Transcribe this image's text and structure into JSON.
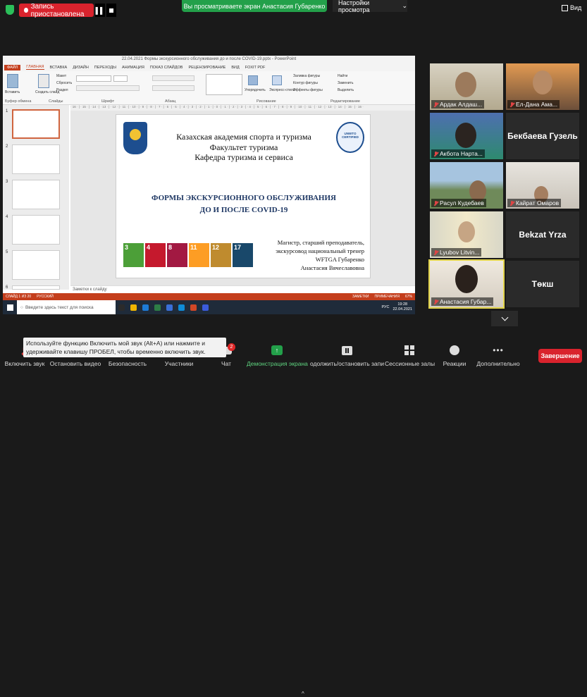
{
  "topbar": {
    "recording_label": "Запись приостановлена",
    "pause_glyph": "▌▌",
    "viewing_banner": "Вы просматриваете экран Анастасия Губаренко",
    "view_settings_label": "Настройки просмотра",
    "view_settings_chevron": "⌄",
    "view_label": "Вид"
  },
  "ppt": {
    "window_title": "22.04.2021 Формы экскурсионного обслуживания до и после COVID-19.pptx - PowerPoint",
    "tabs": [
      "ФАЙЛ",
      "ГЛАВНАЯ",
      "ВСТАВКА",
      "ДИЗАЙН",
      "ПЕРЕХОДЫ",
      "АНИМАЦИЯ",
      "ПОКАЗ СЛАЙДОВ",
      "РЕЦЕНЗИРОВАНИЕ",
      "ВИД",
      "FOXIT PDF"
    ],
    "ribbon_groups": {
      "clipboard": "Буфер обмена",
      "slides": "Слайды",
      "font": "Шрифт",
      "paragraph": "Абзац",
      "drawing": "Рисование",
      "editing": "Редактирование"
    },
    "ribbon_buttons": {
      "paste": "Вставить",
      "new_slide": "Создать слайд",
      "layout": "Макет",
      "reset": "Сбросить",
      "section": "Раздел",
      "arrange": "Упорядочить",
      "quick_styles": "Экспресс-стили",
      "shape_fill": "Заливка фигуры",
      "shape_outline": "Контур фигуры",
      "shape_effects": "Эффекты фигуры",
      "find": "Найти",
      "replace": "Заменить",
      "select": "Выделить"
    },
    "ruler": "· 16 · | · 15 · | · 14 · | · 13 · | · 12 · | · 11 · | · 10 · | · 9 · | · 8 · | · 7 · | · 6 · | · 5 · | · 4 · | · 3 · | · 2 · | · 1 · | · 0 · | · 1 · | · 2 · | · 3 · | · 4 · | · 5 · | · 6 · | · 7 · | · 8 · | · 9 · | · 10 · | · 11 · | · 12 · | · 13 · | · 14 · | · 15 · | · 16 ·",
    "thumbnail_numbers": [
      "1",
      "2",
      "3",
      "4",
      "5",
      "6"
    ],
    "slide": {
      "line1": "Казахская академия спорта и туризма",
      "line2": "Факультет туризма",
      "line3": "Кафедра туризма и сервиса",
      "title1": "ФОРМЫ ЭКСКУРСИОННОГО ОБСЛУЖИВАНИЯ",
      "title2": "ДО И ПОСЛЕ COVID-19",
      "author1": "Магистр, старший преподаватель,",
      "author2": "экскурсовод национальный тренер",
      "author3": "WFTGA Губаренко",
      "author4": "Анастасия Вячеславовна",
      "logo_right_text": "UNWTO CERTIFIED"
    },
    "sdg_numbers": [
      "3",
      "4",
      "8",
      "11",
      "12",
      "17"
    ],
    "sdg_colors": [
      "#4c9f38",
      "#c5192d",
      "#a21942",
      "#fd9d24",
      "#bf8b2e",
      "#19486a"
    ],
    "notes_placeholder": "Заметки к слайду",
    "status": {
      "slide_counter": "СЛАЙД 1 ИЗ 20",
      "language": "РУССКИЙ",
      "notes": "ЗАМЕТКИ",
      "comments": "ПРИМЕЧАНИЯ",
      "zoom": "67%"
    },
    "taskbar": {
      "search_placeholder": "Введите здесь текст для поиска",
      "language": "РУС",
      "time": "19:28",
      "date": "22.04.2021",
      "app_colors": [
        "#2b2b2b",
        "#f0b400",
        "#1e7bd7",
        "#2d7d46",
        "#3a6fd8",
        "#0f8bd6",
        "#d24726",
        "#3b5bdb"
      ]
    }
  },
  "participants": [
    {
      "name": "Ардак Алдаш...",
      "muted": true
    },
    {
      "name": "Ел-Дана Ама...",
      "muted": true
    },
    {
      "name": "Акбота Нарта...",
      "muted": true
    },
    {
      "name": "Бекбаева Гузель",
      "muted": false
    },
    {
      "name": "Расул Кудебаев",
      "muted": true
    },
    {
      "name": "Кайрат Омаров",
      "muted": true
    },
    {
      "name": "Lyubov Litvin...",
      "muted": true
    },
    {
      "name": "Bekzat Yrza",
      "muted": false
    },
    {
      "name": "Анастасия Губар...",
      "muted": true
    },
    {
      "name": "Төкш",
      "muted": false
    }
  ],
  "tooltip": "Используйте функцию Включить мой звук (Alt+A) или нажмите и удерживайте клавишу ПРОБЕЛ, чтобы временно включить звук.",
  "toolbar": {
    "unmute": "Включить звук",
    "start_video": "Остановить видео",
    "security": "Безопасность",
    "participants": "Участники",
    "chat": "Чат",
    "chat_badge": "2",
    "share_screen": "Демонстрация экрана",
    "pause_record": "одолжить/остановить запи",
    "breakout": "Сессионные залы",
    "reactions": "Реакции",
    "more": "Дополнительно",
    "end": "Завершение",
    "more_glyph": "•••",
    "caret_glyph": "^"
  }
}
